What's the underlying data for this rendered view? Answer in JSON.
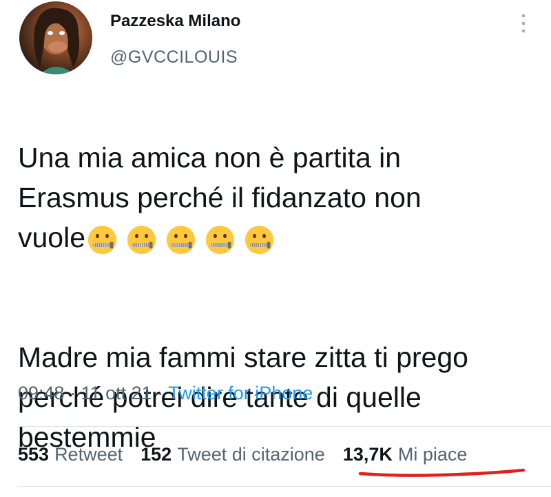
{
  "user": {
    "display_name": "Pazzeska Milano",
    "handle": "@GVCCILOUIS"
  },
  "tweet": {
    "paragraph1": "Una mia amica non è partita in\nErasmus perché il fidanzato non\nvuole",
    "emoji_count": 5,
    "emoji_icon": "zipper-mouth-face",
    "paragraph2": "Madre mia fammi stare zitta ti prego\nperché potrei dire tante di quelle\nbestemmie",
    "time": "09:48",
    "date": "11 ott 21",
    "source": "Twitter for iPhone",
    "separator": "·"
  },
  "stats": {
    "retweets_count": "553",
    "retweets_label": "Retweet",
    "quotes_count": "152",
    "quotes_label": "Tweet di citazione",
    "likes_count": "13,7K",
    "likes_label": "Mi piace"
  },
  "colors": {
    "text": "#0f1419",
    "secondary": "#536471",
    "link": "#1d9bf0",
    "annotation": "#e0221b",
    "emoji_face": "#ffc83d"
  }
}
